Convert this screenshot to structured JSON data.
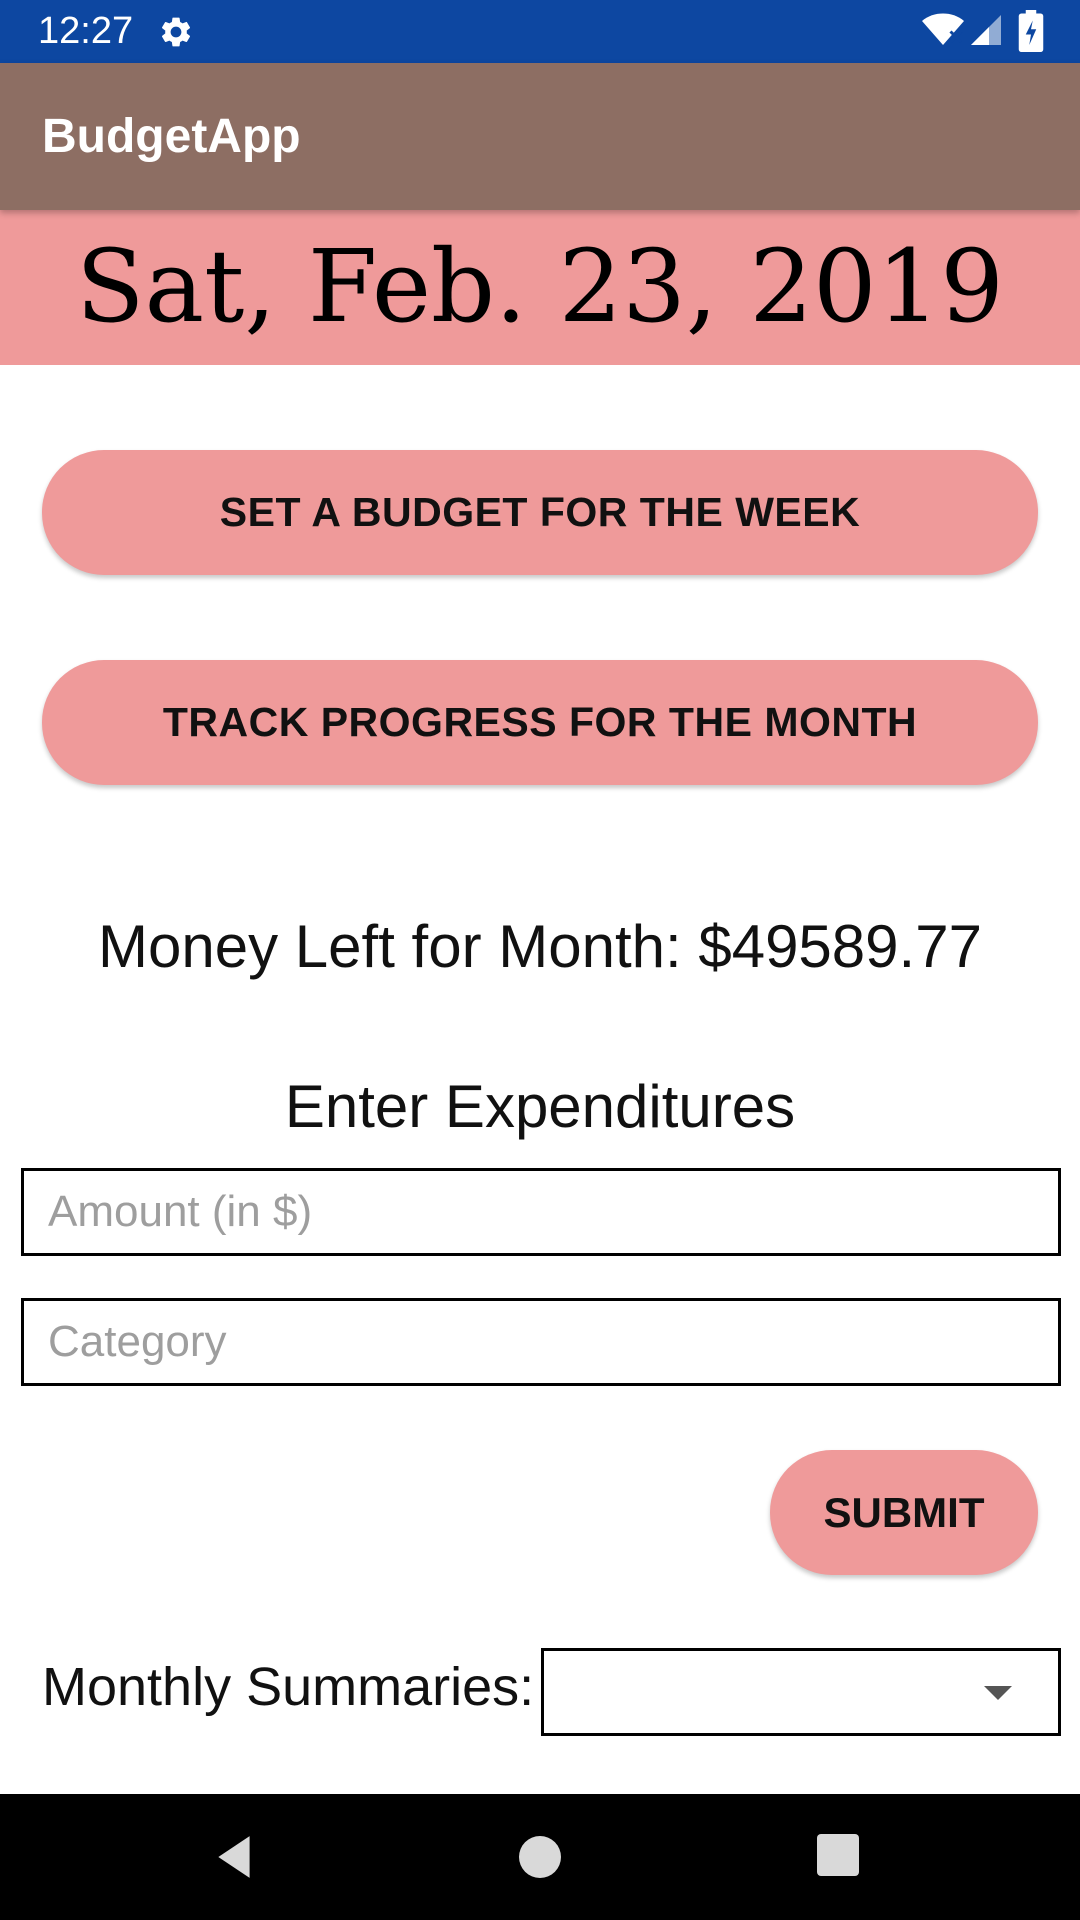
{
  "status_bar": {
    "time": "12:27",
    "icons": [
      "gear-icon",
      "wifi-icon",
      "signal-icon",
      "battery-icon"
    ],
    "background_color": "#0d47a1"
  },
  "app_bar": {
    "title": "BudgetApp",
    "background_color": "#8d6e63"
  },
  "date_banner": {
    "date": "Sat, Feb. 23, 2019",
    "background_color": "#ef9a9a"
  },
  "buttons": {
    "set_budget": "SET A BUDGET FOR THE WEEK",
    "track_progress": "TRACK PROGRESS FOR THE MONTH",
    "submit": "SUBMIT",
    "accent_color": "#ef9a9a"
  },
  "money_left": "Money Left for Month: $49589.77",
  "expenditures": {
    "heading": "Enter Expenditures",
    "amount_placeholder": "Amount (in $)",
    "amount_value": "",
    "category_placeholder": "Category",
    "category_value": ""
  },
  "summaries": {
    "label": "Monthly Summaries:",
    "selected": ""
  },
  "nav_bar": {
    "icons": [
      "back-icon",
      "home-icon",
      "recents-icon"
    ]
  }
}
